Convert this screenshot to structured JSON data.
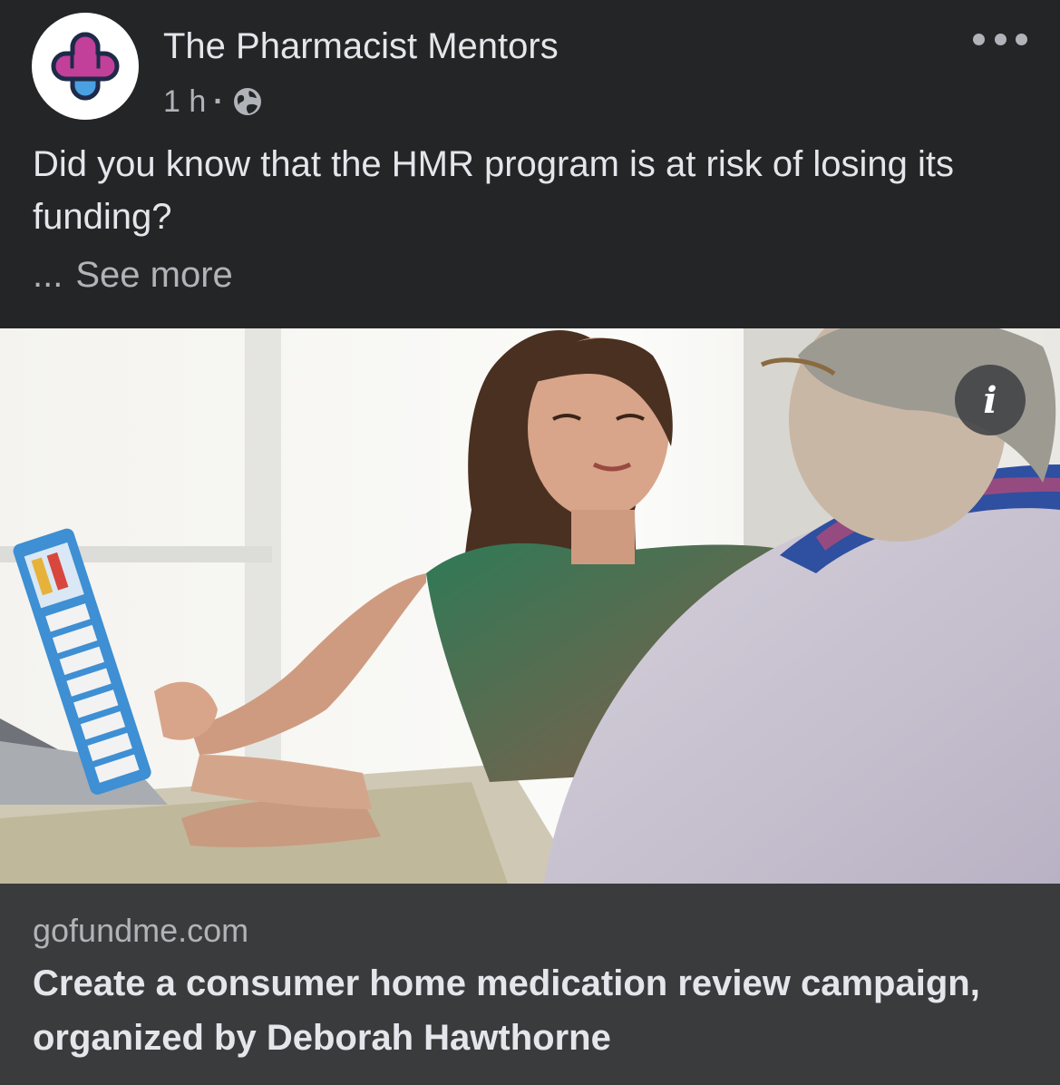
{
  "post": {
    "page_name": "The Pharmacist Mentors",
    "timestamp": "1 h",
    "separator": "·",
    "audience_icon": "globe-icon",
    "more_icon": "more-options-icon",
    "text": "Did you know that the HMR program is at risk of losing its funding?",
    "see_more_ellipsis": "...",
    "see_more_label": "See more"
  },
  "media": {
    "info_icon_glyph": "i"
  },
  "link_preview": {
    "domain": "gofundme.com",
    "title": "Create a consumer home medication review campaign, organized by Deborah Hawthorne"
  },
  "colors": {
    "background": "#242526",
    "card_background": "#3a3b3c",
    "primary_text": "#e4e6eb",
    "secondary_text": "#b0b3b8",
    "logo_magenta": "#c2409a",
    "logo_blue": "#4aa0e0"
  }
}
